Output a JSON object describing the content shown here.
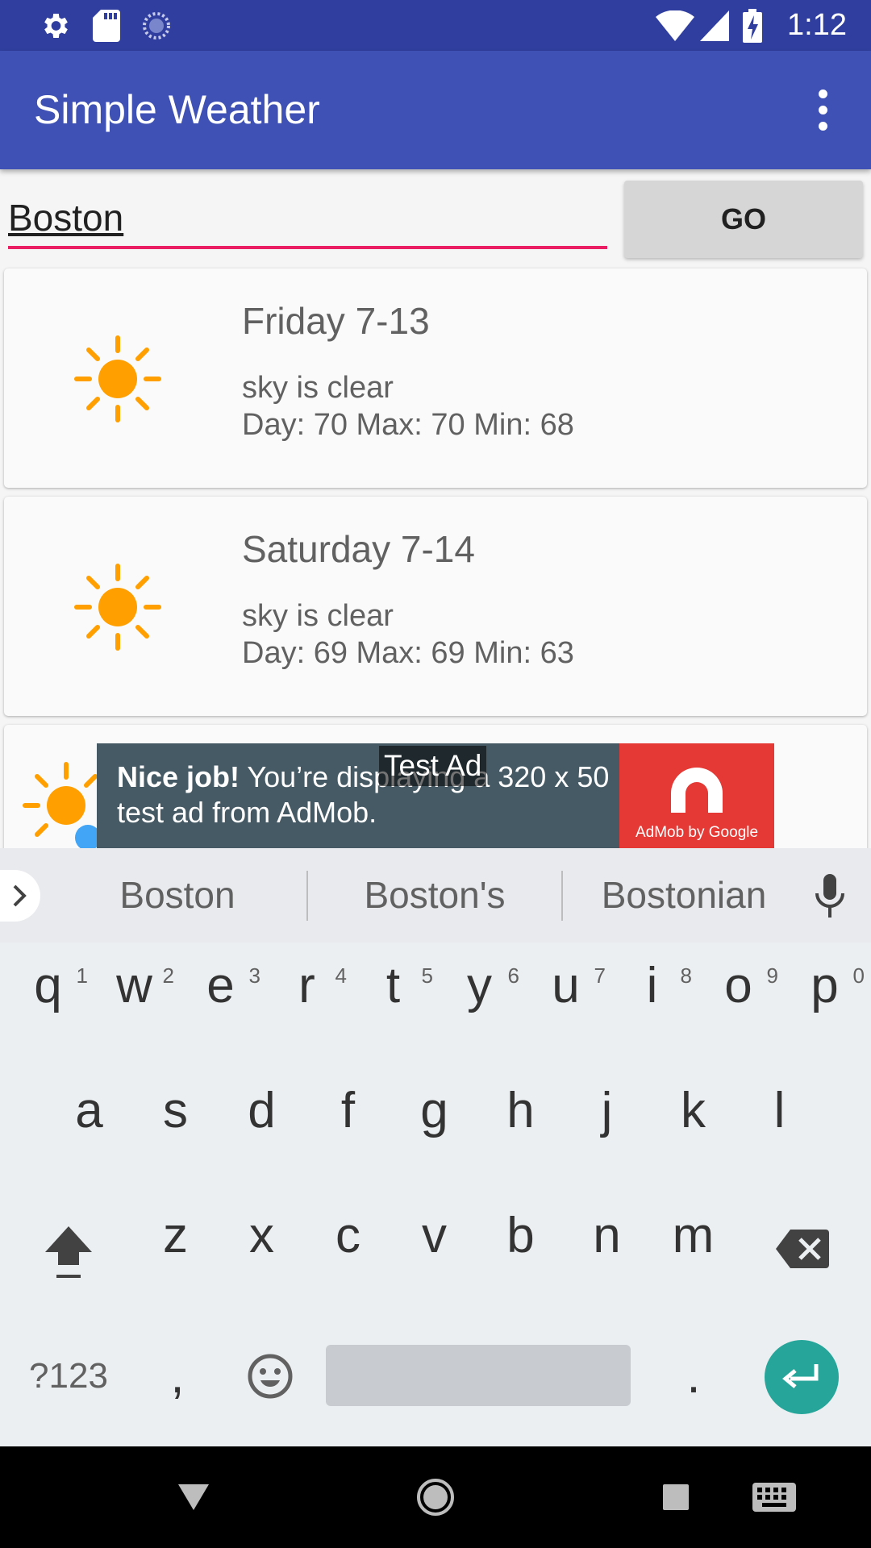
{
  "status_bar": {
    "time": "1:12",
    "icons": [
      "settings-icon",
      "sd-card-icon",
      "sync-icon",
      "wifi-icon",
      "signal-icon",
      "battery-charging-icon"
    ]
  },
  "app_bar": {
    "title": "Simple Weather",
    "menu_icon": "more-vert-icon"
  },
  "search": {
    "value": "Boston",
    "button_label": "GO"
  },
  "forecast": [
    {
      "day": "Friday 7-13",
      "description": "sky is clear",
      "temps": "Day: 70 Max: 70 Min: 68",
      "icon": "sun-icon"
    },
    {
      "day": "Saturday 7-14",
      "description": "sky is clear",
      "temps": "Day: 69 Max: 69 Min: 63",
      "icon": "sun-icon"
    }
  ],
  "partial_card_icon": "partly-cloudy-icon",
  "ad": {
    "label": "Test Ad",
    "headline": "Nice job!",
    "body": "You’re displaying a 320 x 50 test ad from AdMob.",
    "logo_caption": "AdMob by Google"
  },
  "keyboard": {
    "suggestions": [
      "Boston",
      "Boston's",
      "Bostonian"
    ],
    "row1": [
      {
        "key": "q",
        "hint": "1"
      },
      {
        "key": "w",
        "hint": "2"
      },
      {
        "key": "e",
        "hint": "3"
      },
      {
        "key": "r",
        "hint": "4"
      },
      {
        "key": "t",
        "hint": "5"
      },
      {
        "key": "y",
        "hint": "6"
      },
      {
        "key": "u",
        "hint": "7"
      },
      {
        "key": "i",
        "hint": "8"
      },
      {
        "key": "o",
        "hint": "9"
      },
      {
        "key": "p",
        "hint": "0"
      }
    ],
    "row2": [
      "a",
      "s",
      "d",
      "f",
      "g",
      "h",
      "j",
      "k",
      "l"
    ],
    "row3": [
      "z",
      "x",
      "c",
      "v",
      "b",
      "n",
      "m"
    ],
    "symbols_label": "?123",
    "comma": ",",
    "period": "."
  },
  "colors": {
    "status_bar": "#303f9f",
    "app_bar": "#3f51b5",
    "accent": "#e91e63",
    "sun": "#ffa000",
    "enter_key": "#26a69a",
    "ad_background": "#455a64",
    "ad_logo": "#e53935"
  }
}
